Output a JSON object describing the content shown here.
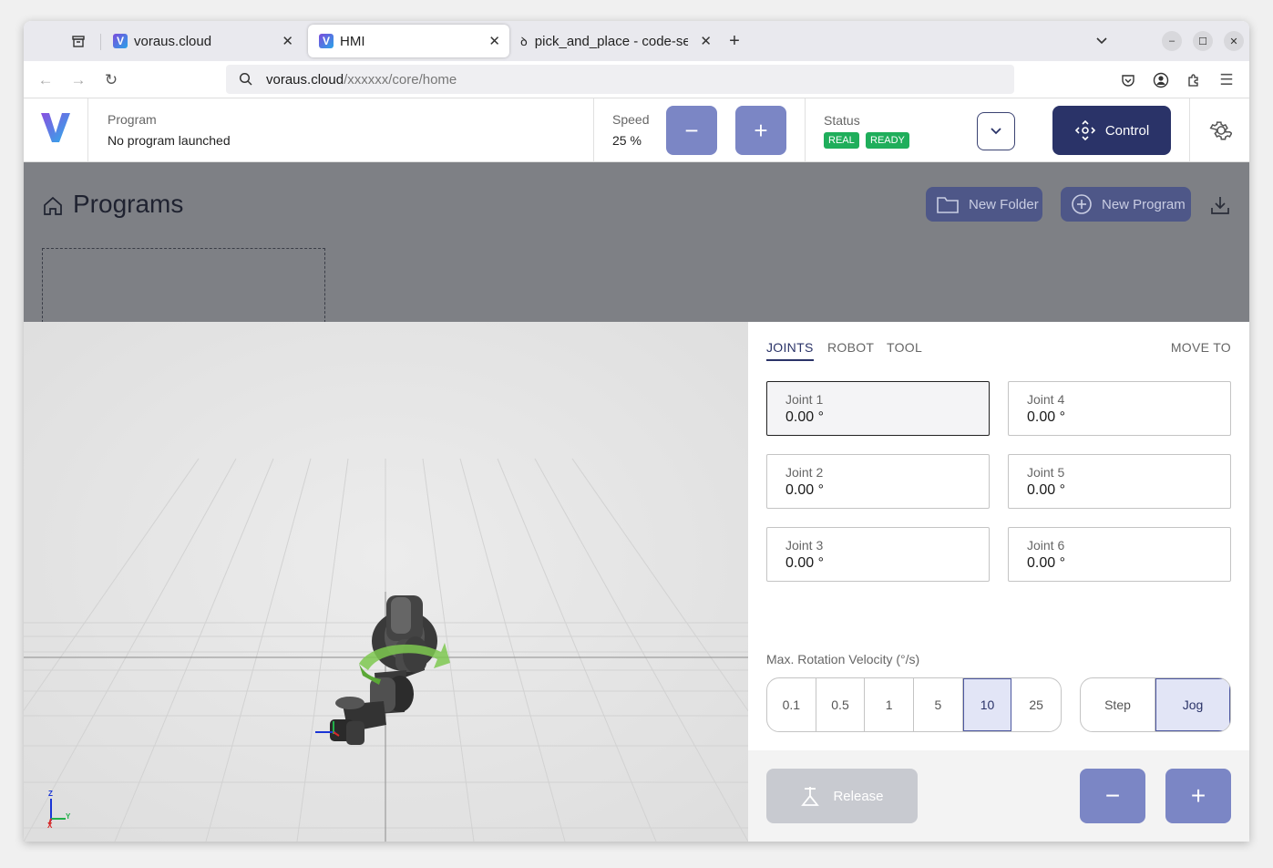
{
  "browser": {
    "tabs": [
      {
        "label": "voraus.cloud",
        "favicon": "V"
      },
      {
        "label": "HMI",
        "favicon": "V"
      },
      {
        "label": "pick_and_place - code-ser"
      }
    ],
    "url_host": "voraus.cloud",
    "url_path": "/xxxxxx/core/home"
  },
  "header": {
    "logo": "V",
    "program_label": "Program",
    "program_value": "No program launched",
    "speed_label": "Speed",
    "speed_value": "25 %",
    "speed_minus": "−",
    "speed_plus": "+",
    "status_label": "Status",
    "badges": [
      "REAL",
      "READY"
    ],
    "control_label": "Control"
  },
  "programs": {
    "title": "Programs",
    "new_folder": "New Folder",
    "new_program": "New Program"
  },
  "panel": {
    "tabs": [
      "JOINTS",
      "ROBOT",
      "TOOL"
    ],
    "move_to": "MOVE TO",
    "joints": [
      {
        "label": "Joint 1",
        "value": "0.00 °"
      },
      {
        "label": "Joint 4",
        "value": "0.00 °"
      },
      {
        "label": "Joint 2",
        "value": "0.00 °"
      },
      {
        "label": "Joint 5",
        "value": "0.00 °"
      },
      {
        "label": "Joint 3",
        "value": "0.00 °"
      },
      {
        "label": "Joint 6",
        "value": "0.00 °"
      }
    ],
    "velocity_label": "Max. Rotation Velocity (°/s)",
    "velocity_options": [
      "0.1",
      "0.5",
      "1",
      "5",
      "10",
      "25"
    ],
    "velocity_selected": "10",
    "mode_options": [
      "Step",
      "Jog"
    ],
    "mode_selected": "Jog",
    "release": "Release",
    "minus": "−",
    "plus": "+"
  },
  "axes": {
    "z": "Z",
    "y": "Y",
    "x": "X"
  },
  "colors": {
    "accent": "#2a3368",
    "button": "#7b86c5",
    "status_green": "#1fae5b"
  }
}
